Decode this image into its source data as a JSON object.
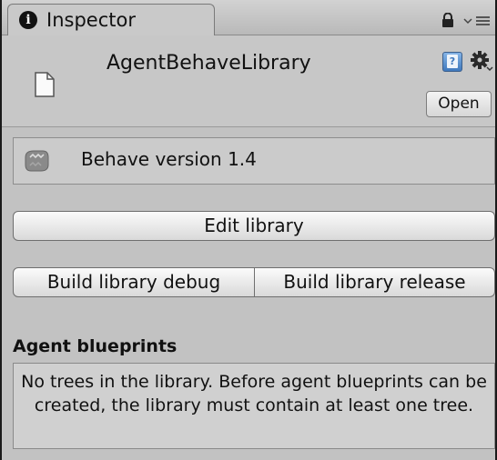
{
  "tab": {
    "label": "Inspector"
  },
  "header": {
    "title": "AgentBehaveLibrary",
    "open_label": "Open"
  },
  "version": {
    "text": "Behave version 1.4"
  },
  "actions": {
    "edit_label": "Edit library",
    "build_debug_label": "Build library debug",
    "build_release_label": "Build library release"
  },
  "blueprints": {
    "title": "Agent blueprints",
    "message": "No trees in the library. Before agent blueprints can be created, the library must contain at least one tree."
  },
  "icons": {
    "tab": "info-icon",
    "lock": "lock-icon",
    "menu": "tab-menu-icon",
    "asset": "document-icon",
    "help": "help-book-icon",
    "settings": "gear-icon",
    "behave": "behave-logo-icon"
  },
  "colors": {
    "panel_bg": "#c2c2c2",
    "help_blue": "#3f78bd"
  }
}
